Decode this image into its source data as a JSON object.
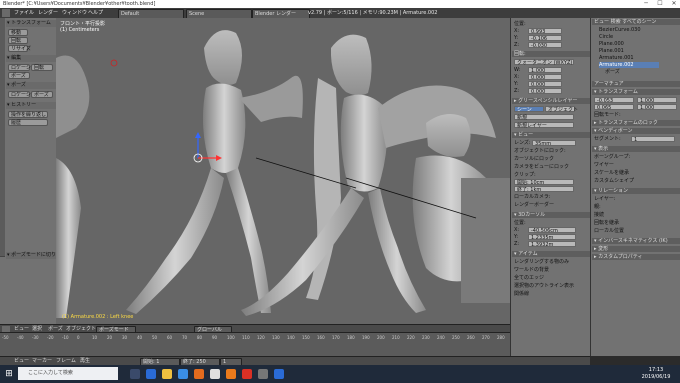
{
  "title_bar": {
    "title": "Blender* [C:¥Users¥Documents¥Blender¥other¥tooth.blend]",
    "minimize": "─",
    "maximize": "☐",
    "close": "✕"
  },
  "info_header": {
    "menus": [
      "ファイル",
      "レンダー",
      "ウィンドウ",
      "ヘルプ"
    ],
    "layout_field": "Default",
    "scene_field": "Scene",
    "engine_field": "Blender レンダー",
    "stats": "v2.79 | ボーン:5/116 | メモリ:90.23M | Armature.002"
  },
  "toolshelf": {
    "tabs": [
      "ツール",
      "作成",
      "リレーション",
      "アニメーション",
      "物理演算",
      "グリースペンシル"
    ],
    "transform_header": "▾ トランスフォーム",
    "transform_buttons": [
      "移動",
      "回転",
      "リサイズ"
    ],
    "edit_header": "▾ 編集",
    "edit_buttons": [
      "ロケーション",
      "回転",
      "ポーズ",
      "スケール"
    ],
    "pose_header": "▾ ポーズ",
    "pose_buttons": [
      "ロケーション",
      "ポーズ"
    ],
    "history_header": "▾ ヒストリー",
    "history_buttons": [
      "操作を繰り返し",
      "履歴"
    ],
    "bottom_label": "▾ ポーズモードに切り替え"
  },
  "viewport": {
    "info_line1": "フロント・平行投影",
    "info_line2": "(1) Centimeters",
    "object_label": "(1) Armature.002 : Left knee"
  },
  "viewport_header": {
    "items": [
      "ビュー",
      "選択",
      "ポーズ",
      "オブジェクト",
      "ポーズモード",
      "グローバル"
    ]
  },
  "npanel": {
    "transform_header": "▾ トランスフォーム",
    "location_label": "位置:",
    "rows": [
      {
        "axis": "X:",
        "value": "0.993"
      },
      {
        "axis": "Y:",
        "value": "-0.106"
      },
      {
        "axis": "Z:",
        "value": "-0.030"
      }
    ],
    "rotation_header": "回転:",
    "rotation_mode": "クォータニオン (WXYZ)",
    "rotation_rows": [
      {
        "axis": "W:",
        "value": "1.000"
      },
      {
        "axis": "X:",
        "value": "0.000"
      },
      {
        "axis": "Y:",
        "value": "0.000"
      },
      {
        "axis": "Z:",
        "value": "0.000"
      }
    ],
    "grease_header": "▸ グリースペンシルレイヤー",
    "scene_btn": "シーン",
    "object_btn": "オブジェクト",
    "new_btn": "新規",
    "new_layer": "新規レイヤー",
    "view_header": "▾ ビュー",
    "lens_label": "レンズ:",
    "lens_value": "35mm",
    "lock_label": "オブジェクトにロック:",
    "cursor_label": "カーソルにロック",
    "camera_label": "カメラをビューにロック",
    "clip_header": "クリップ:",
    "clip_start": "開始: 10cm",
    "clip_end": "終了: 1km",
    "local_camera": "ローカルカメラ:",
    "render_border": "レンダーボーダー",
    "cursor3d_header": "▾ 3Dカーソル",
    "cursor_loc": "位置:",
    "cursor_rows": [
      {
        "axis": "X:",
        "value": "-40.506cm"
      },
      {
        "axis": "Y:",
        "value": "1.2335m"
      },
      {
        "axis": "Z:",
        "value": "1.3932m"
      }
    ],
    "item_header": "▾ アイテム",
    "render_only": "レンダリングする物のみ",
    "world_bg": "ワールドの背景",
    "all_edges": "全てのエッジ",
    "outline_sel": "選択物のアウトライン表示",
    "relation_lines": "関係線"
  },
  "outliner": {
    "header": "ビュー  検索  すべてのシーン",
    "items": [
      "BezierCurve.030",
      "Circle",
      "Plane.000",
      "Plane.001",
      "Armature.001",
      "Armature.002",
      "ポーズ"
    ]
  },
  "propeditor": {
    "header": "アーマチュア",
    "transform_header": "▾ トランスフォーム",
    "loc_values": [
      "-0.053",
      "1.000",
      "0.065",
      "1.000"
    ],
    "rotation_mode_label": "回転モード:",
    "transform_lock": "▸ トランスフォームのロック",
    "bendy_header": "▾ ベンディボーン",
    "segments_label": "セグメント:",
    "segments_value": "1",
    "display_header": "▾ 表示",
    "bone_group_header": "ボーングループ:",
    "wire_label": "ワイヤー",
    "inherit_scale": "スケールを継承",
    "custom_shape": "カスタムシェイプ",
    "relations_header": "▾ リレーション",
    "layer_label": "レイヤー:",
    "parent_label": "親:",
    "connected": "接続",
    "inherit_rot": "回転を継承",
    "local_loc": "ローカル位置",
    "inverse_kin": "▾ インバースキネマティクス (IK)",
    "deform": "▸ 変形",
    "custom_props": "▸ カスタムプロパティ"
  },
  "timeline": {
    "ticks": [
      "-50",
      "-40",
      "-30",
      "-20",
      "-10",
      "0",
      "10",
      "20",
      "30",
      "40",
      "50",
      "60",
      "70",
      "80",
      "90",
      "100",
      "110",
      "120",
      "130",
      "140",
      "150",
      "160",
      "170",
      "180",
      "190",
      "200",
      "210",
      "220",
      "230",
      "240",
      "250",
      "260",
      "270",
      "280"
    ],
    "header_items": [
      "ビュー",
      "マーカー",
      "フレーム",
      "再生"
    ],
    "start_label": "開始: 1",
    "end_label": "終了: 250",
    "frame": "1"
  },
  "taskbar": {
    "search_placeholder": "ここに入力して検索",
    "time": "17:13",
    "date": "2019/06/19"
  }
}
